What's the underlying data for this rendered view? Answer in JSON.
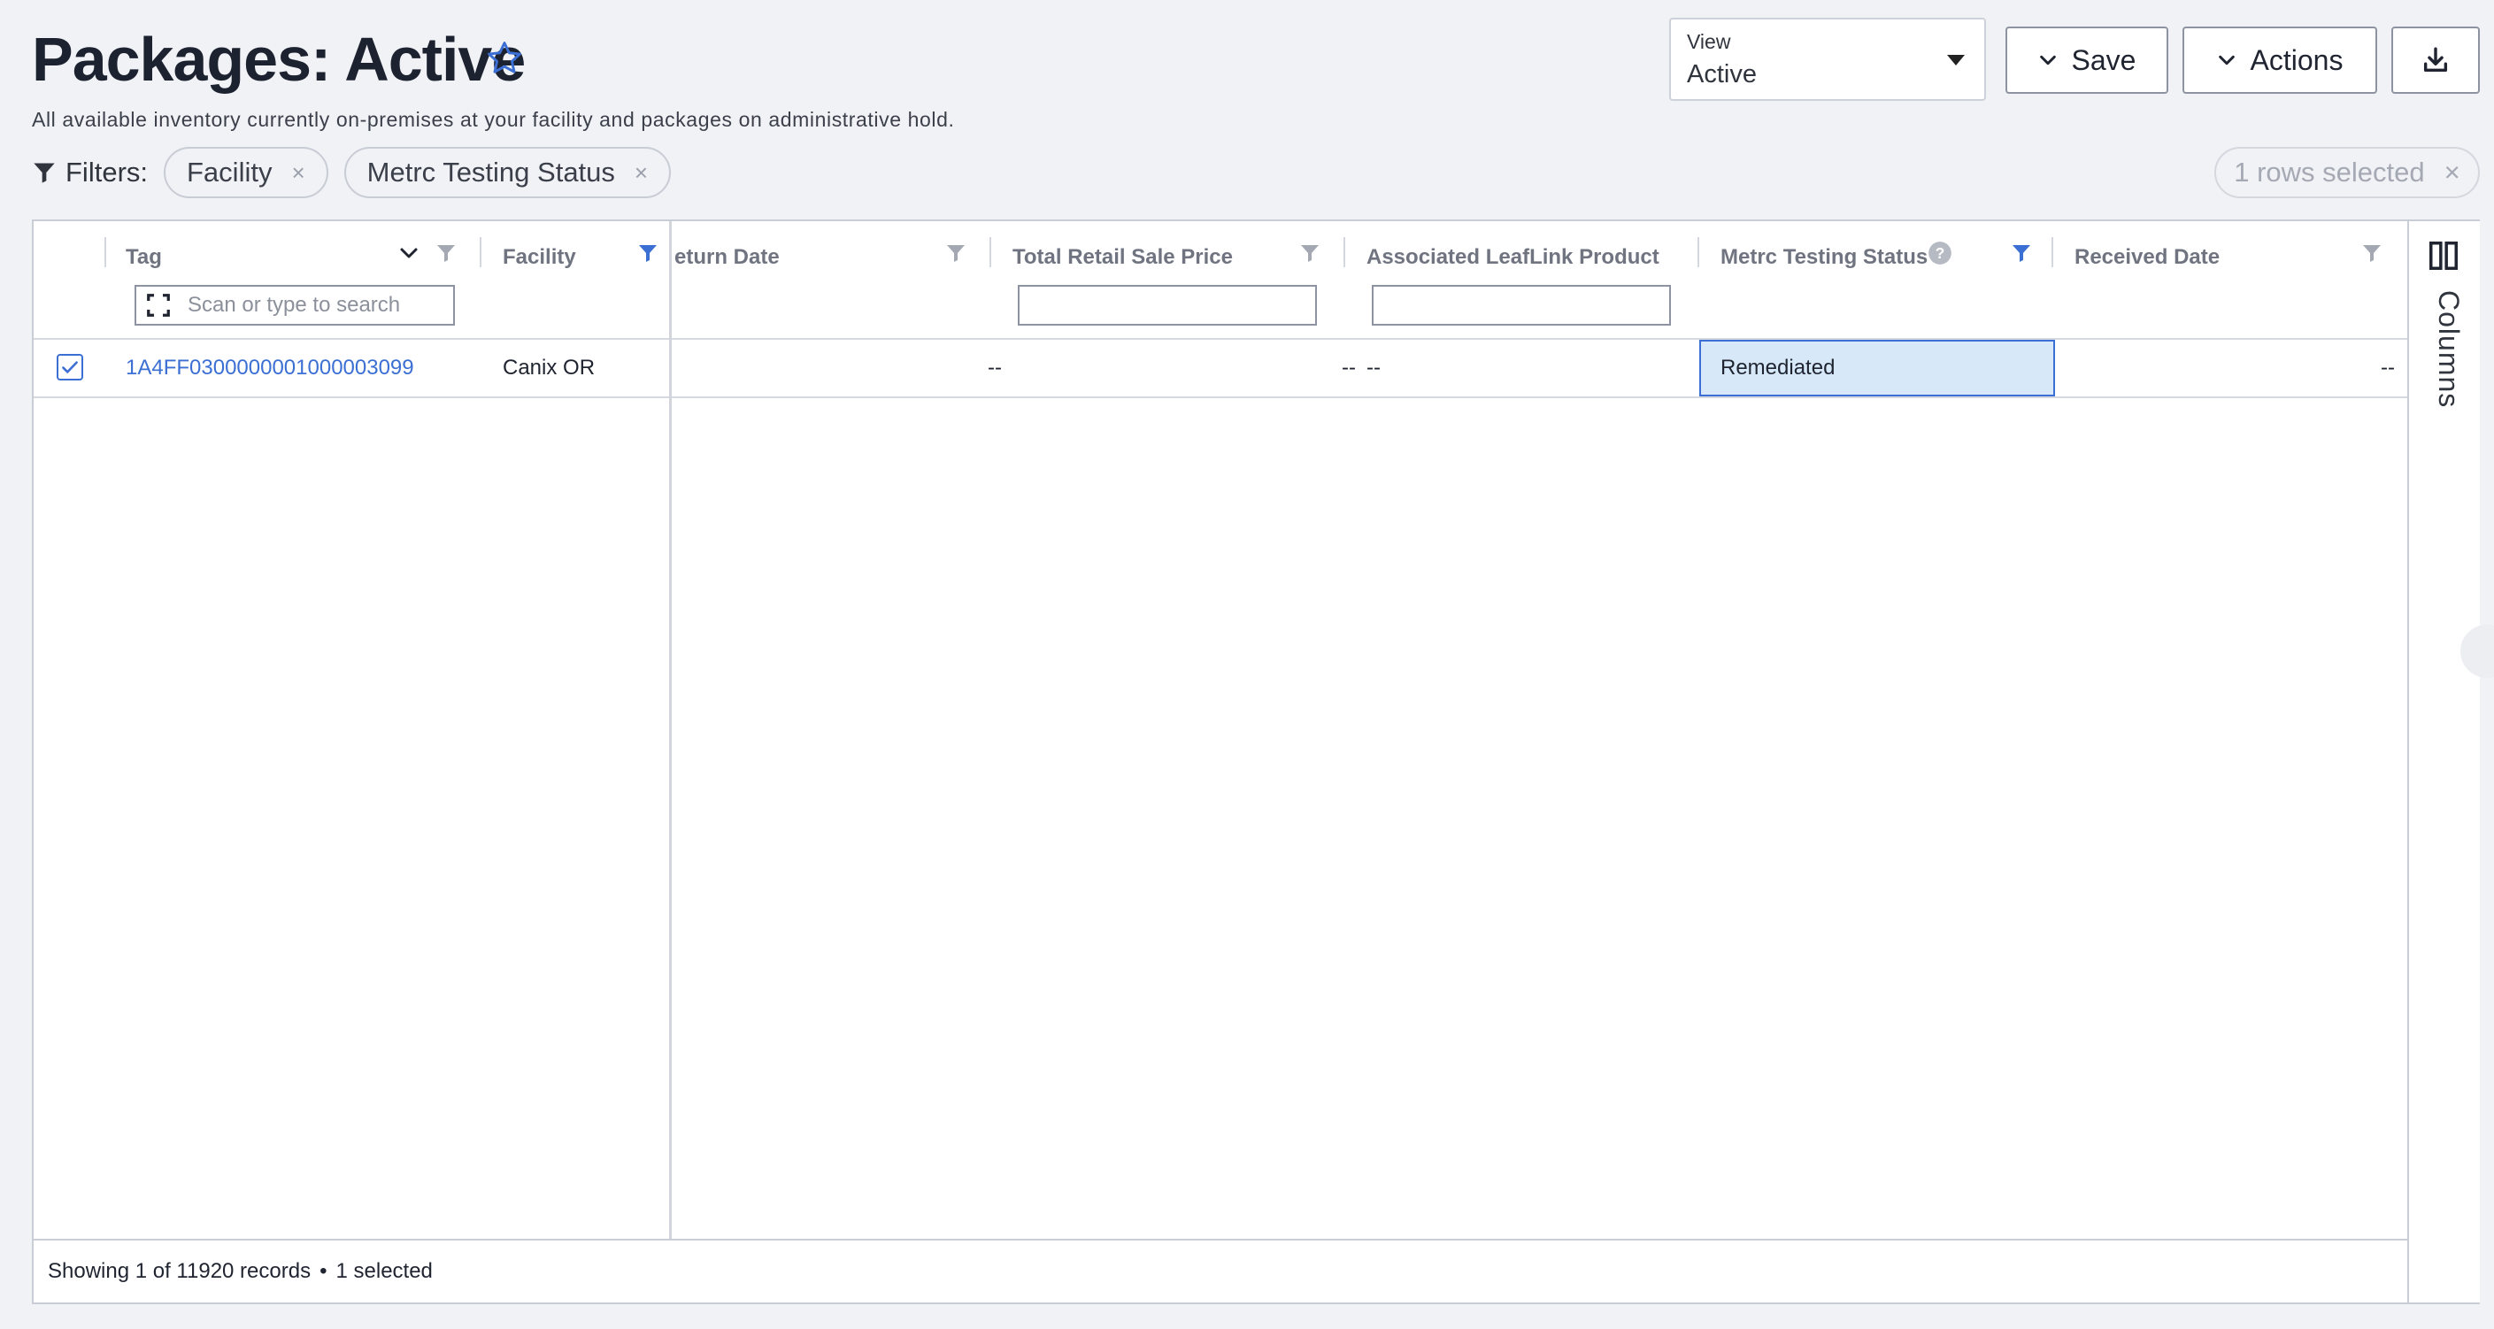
{
  "header": {
    "title": "Packages: Active",
    "subtitle": "All available inventory currently on-premises at your facility and packages on administrative hold."
  },
  "view_select": {
    "label": "View",
    "value": "Active"
  },
  "toolbar": {
    "save_label": "Save",
    "actions_label": "Actions"
  },
  "filters": {
    "label": "Filters:",
    "chips": [
      "Facility",
      "Metrc Testing Status"
    ],
    "remove_glyph": "×"
  },
  "selection": {
    "text": "1 rows selected",
    "clear_glyph": "×"
  },
  "grid": {
    "columns": {
      "tag": "Tag",
      "facility": "Facility",
      "return_date": "eturn Date",
      "total_retail_sale_price": "Total Retail Sale Price",
      "associated_leaflink_product": "Associated LeafLink Product",
      "metrc_testing_status": "Metrc Testing Status",
      "received_date": "Received Date"
    },
    "tag_search_placeholder": "Scan or type to search",
    "rows": [
      {
        "selected": true,
        "tag": "1A4FF0300000001000003099",
        "facility": "Canix OR",
        "return_date": "--",
        "total_retail_sale_price": "--",
        "associated_leaflink_product": "--",
        "metrc_testing_status": "Remediated",
        "received_date": "--"
      }
    ]
  },
  "side_panel": {
    "columns_label": "Columns"
  },
  "footer": {
    "records_text": "Showing 1 of 11920 records",
    "separator": "•",
    "selected_text": "1 selected"
  },
  "colors": {
    "accent": "#3b6fd4",
    "selected_cell_bg": "#d7e8f8",
    "page_bg": "#f1f2f6"
  },
  "icons": [
    "star-icon",
    "chevron-down-icon",
    "download-icon",
    "filter-icon",
    "help-icon",
    "scan-icon",
    "columns-icon",
    "checkbox-checked-icon"
  ]
}
